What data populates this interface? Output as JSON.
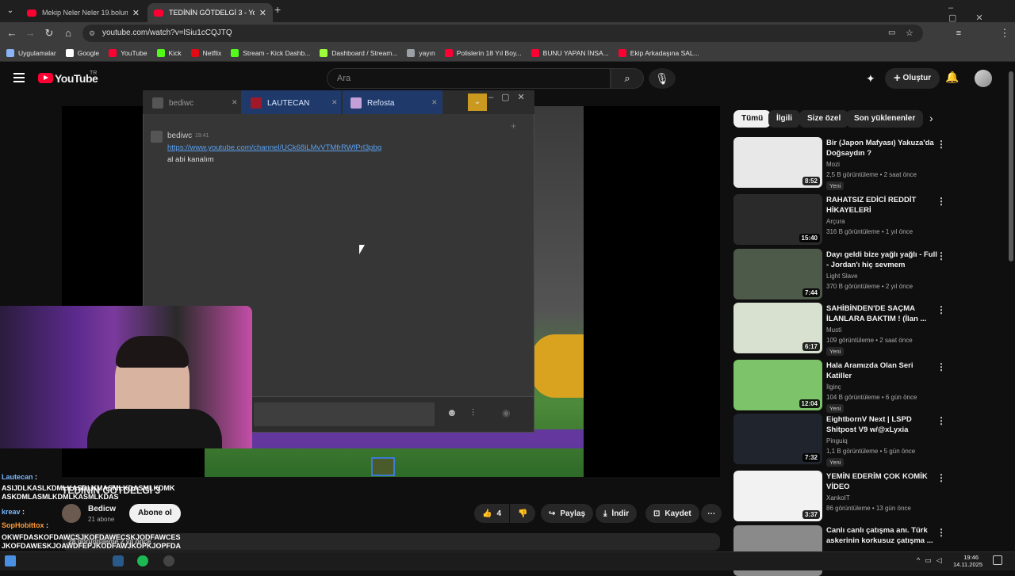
{
  "browser": {
    "tabs": [
      {
        "title": "Mekip Neler Neler 19.bolum - Y",
        "active": false
      },
      {
        "title": "TEDİNİN GÖTDELGİ 3 - YouTub",
        "active": true
      }
    ],
    "new_tab": "+",
    "url": "youtube.com/watch?v=lSiu1cCQJTQ",
    "bookmarks": [
      {
        "label": "Uygulamalar",
        "color": "#8ab4f8"
      },
      {
        "label": "Google",
        "color": "#ffffff"
      },
      {
        "label": "YouTube",
        "color": "#ff0033"
      },
      {
        "label": "Kick",
        "color": "#53fc18"
      },
      {
        "label": "Netflix",
        "color": "#e50914"
      },
      {
        "label": "Stream - Kick Dashb...",
        "color": "#53fc18"
      },
      {
        "label": "Dashboard / Stream...",
        "color": "#9cff3a"
      },
      {
        "label": "yayın",
        "color": "#9aa0a6"
      },
      {
        "label": "Polislerin 18 Yıl Boy...",
        "color": "#ff0033"
      },
      {
        "label": "BUNU YAPAN İNSA...",
        "color": "#ff0033"
      },
      {
        "label": "Ekip Arkadaşına SAL...",
        "color": "#ff0033"
      }
    ]
  },
  "youtube": {
    "logo": "YouTube",
    "logo_sup": "TR",
    "search_placeholder": "Ara",
    "create_label": "Oluştur",
    "video_title": "TEDİNİN GÖTDELGİ 3",
    "channel": "Bedicw",
    "subs": "21 abone",
    "subscribe": "Abone ol",
    "likes": "4",
    "share": "Paylaş",
    "download": "İndir",
    "save": "Kaydet",
    "views_line": "28 görüntüleme  2 yıl önce",
    "chips": [
      "Tümü",
      "İlgili",
      "Size özel",
      "Son yüklenenler"
    ],
    "recommendations": [
      {
        "title": "Bir (Japon Mafyası) Yakuza'da Doğsaydın ?",
        "channel": "Mozi",
        "meta": "2,5 B görüntüleme • 2 saat önce",
        "badge": "Yeni",
        "duration": "8:52",
        "color": "#e8e8e8"
      },
      {
        "title": "RAHATSIZ EDİCİ REDDİT HİKAYELERİ",
        "channel": "Arçura",
        "meta": "316 B görüntüleme • 1 yıl önce",
        "badge": "",
        "duration": "15:40",
        "color": "#2a2a2a"
      },
      {
        "title": "Dayı geldi bize yağlı yağlı - Full - Jordan'ı hiç sevmem",
        "channel": "Light Slave",
        "meta": "370 B görüntüleme • 2 yıl önce",
        "badge": "",
        "duration": "7:44",
        "color": "#4d5a4a"
      },
      {
        "title": "SAHİBİNDEN'DE SAÇMA İLANLARA BAKTIM ! (İlan ...",
        "channel": "Musti",
        "meta": "109 görüntüleme • 2 saat önce",
        "badge": "Yeni",
        "duration": "6:17",
        "color": "#d8e0d0"
      },
      {
        "title": "Hala Aramızda Olan Seri Katiller",
        "channel": "İlginç",
        "meta": "104 B görüntüleme • 6 gün önce",
        "badge": "Yeni",
        "duration": "12:04",
        "color": "#7cc36a"
      },
      {
        "title": "EightbornV Next | LSPD Shitpost V9 w/@xLyxia",
        "channel": "Pinguiq",
        "meta": "1,1 B görüntüleme • 5 gün önce",
        "badge": "Yeni",
        "duration": "7:32",
        "color": "#20242c"
      },
      {
        "title": "YEMİN EDERİM ÇOK KOMİK VİDEO",
        "channel": "XankoIT",
        "meta": "86 görüntüleme • 13 gün önce",
        "badge": "",
        "duration": "3:37",
        "color": "#f2f2f2"
      },
      {
        "title": "Canlı canlı çatışma anı. Türk askerinin korkusuz çatışma ...",
        "channel": "",
        "meta": "",
        "badge": "",
        "duration": "",
        "color": "#8a8a8a"
      }
    ]
  },
  "chat_window": {
    "tabs": [
      "bediwc",
      "LAUTECAN",
      "Refosta"
    ],
    "message_user": "bediwc",
    "message_time": "19:41",
    "message_link": "https://www.youtube.com/channel/UCk68iLMvVTMfrRWfPrl3pbg",
    "message_text": "al abi kanalım"
  },
  "stream_chat": [
    {
      "user": "Lautecan",
      "text": "ASIJDLKASLKDMLKASDLKMASMLKDASMLKDMK ASKDMLASMLKDMLKASMLKDAS",
      "color": "#7ab8ff"
    },
    {
      "user": "kreav",
      "text": "",
      "color": "#7ab8ff"
    },
    {
      "user": "SopHobittox",
      "text": "OKWFDASKOFDAWCSJKOFDAWECSKJODFAWCES JKOFDAWESKJOAWDFEPJKODFAWJKOPKJOPFDA EWJKOPDFWAJKOPDFAWES",
      "color": "#ff9a3a"
    }
  ],
  "taskbar": {
    "time": "19:46",
    "date": "14.11.2025"
  }
}
